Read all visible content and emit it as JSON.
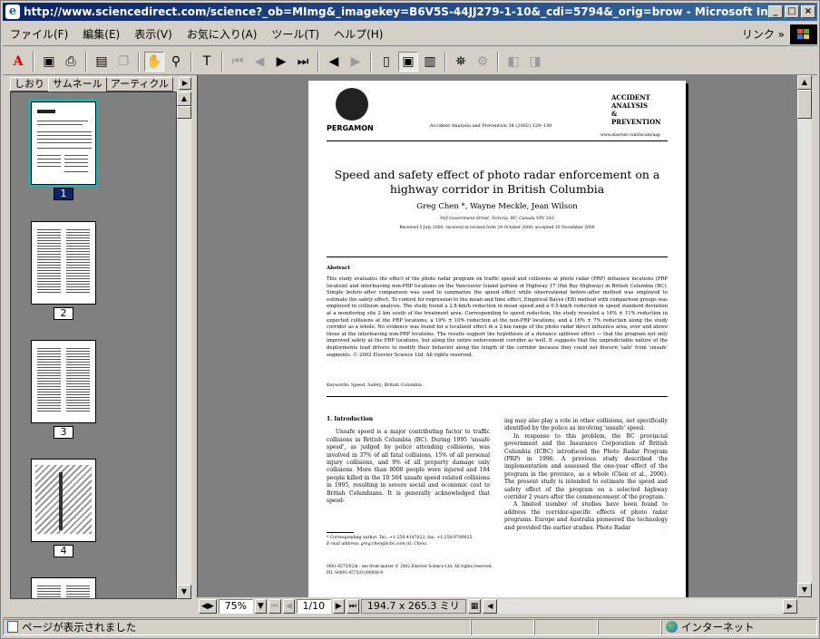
{
  "window": {
    "title": "http://www.sciencedirect.com/science?_ob=MImg&_imagekey=B6V5S-44JJ279-1-10&_cdi=5794&_orig=brow - Microsoft Internet Explorer",
    "minimize": "_",
    "maximize": "□",
    "close": "×"
  },
  "menu": {
    "items": [
      "ファイル(F)",
      "編集(E)",
      "表示(V)",
      "お気に入り(A)",
      "ツール(T)",
      "ヘルプ(H)"
    ],
    "links_label": "リンク »"
  },
  "left_panel": {
    "tabs": [
      "しおり",
      "サムネール",
      "アーティクル"
    ],
    "active_tab": 1,
    "thumbnails": [
      "1",
      "2",
      "3",
      "4"
    ],
    "selected_thumbnail": 0
  },
  "document": {
    "publisher": "PERGAMON",
    "journal_line": "Accident Analysis and Prevention 34 (2002) 129–138",
    "journal_name_lines": [
      "ACCIDENT",
      "ANALYSIS",
      "&",
      "PREVENTION"
    ],
    "journal_url": "www.elsevier.com/locate/aap",
    "title": "Speed and safety effect of photo radar enforcement on a highway corridor in British Columbia",
    "authors": "Greg Chen *, Wayne Meckle, Jean Wilson",
    "address": "910 Government Street, Victoria, BC, Canada V8V 3A3",
    "received": "Received 5 July 2000; received in revised form 24 October 2000; accepted 30 November 2000",
    "abstract_heading": "Abstract",
    "abstract": "This study evaluates the effect of the photo radar program on traffic speed and collisions at photo radar (PRP) influence locations (PRP location) and interleaving non-PRP locations on the Vancouver Island portion of Highway 17 (Pat Bay Highway) in British Columbia (BC). Simple before–after comparison was used to summarize the speed effect while observational before–after method was employed to estimate the safety effect. To control for regression to the mean and time effect, Empirical Bayes (EB) method with comparison groups was employed in collision analysis. The study found a 2.8-km/h reduction in mean speed and a 0.5-km/h reduction in speed standard deviation at a monitoring site 2 km south of the treatment area. Corresponding to speed reduction, the study revealed a 14% ± 11% reduction in expected collisions at the PRP locations, a 19% ± 10% reduction at the non-PRP locations, and a 16% ± 7% reduction along the study corridor as a whole. No evidence was found for a localized effect in a 2-km range of the photo radar direct influence area, over and above those at the interleaving non-PRP locations. The results support the hypothesis of a distance spillover effect — that the program not only improved safety at the PRP locations, but along the entire enforcement corridor as well. It suggests that the unpredictable nature of the deployments lead drivers to modify their behavior along the length of the corridor because they could not discern 'safe' from 'unsafe' segments. © 2002 Elsevier Science Ltd. All rights reserved.",
    "keywords": "Keywords: Speed; Safety; British Columbia",
    "intro_heading": "1. Introduction",
    "col1_text": "Unsafe speed is a major contributing factor to traffic collisions in British Columbia (BC). During 1995 'unsafe speed', as judged by police attending collisions, was involved in 37% of all fatal collisions, 15% of all personal injury collisions, and 9% of all property damage only collisions. More than 8000 people were injured and 184 people killed in the 10 564 unsafe speed related collisions in 1995, resulting in severe social and economic cost to British Columbians. It is generally acknowledged that speed-",
    "col2_text_1": "ing may also play a role in other collisions, not specifically identified by the police as involving 'unsafe' speed.",
    "col2_text_2": "In response to this problem, the BC provincial government and the Insurance Corporation of British Columbia (ICBC) introduced the Photo Radar Program (PRP) in 1996. A previous study described the implementation and assessed the one-year effect of the program in the province, as a whole (Chen et al., 2000). The present study is intended to estimate the speed and safety effect of the program on a selected highway corridor 2 years after the commencement of the program.",
    "col2_text_3": "A limited number of studies have been found to address the corridor-specific effects of photo radar programs. Europe and Australia pioneered the technology and provided the earlier studies. Photo Radar",
    "footnote": "* Corresponding author. Tel.: +1-250-4147022; fax: +1-250-9789025.",
    "email": "E-mail address: greg.chen@icbc.com (G. Chen).",
    "issn": "0001-4575/02/$ - see front matter © 2002 Elsevier Science Ltd. All rights reserved.",
    "pii": "PII: S0001-4575(01)00006-9"
  },
  "nav": {
    "zoom": "75%",
    "page": "1/10",
    "page_size": "194.7 x 265.3 ミリ"
  },
  "status": {
    "message": "ページが表示されました",
    "zone": "インターネット"
  }
}
